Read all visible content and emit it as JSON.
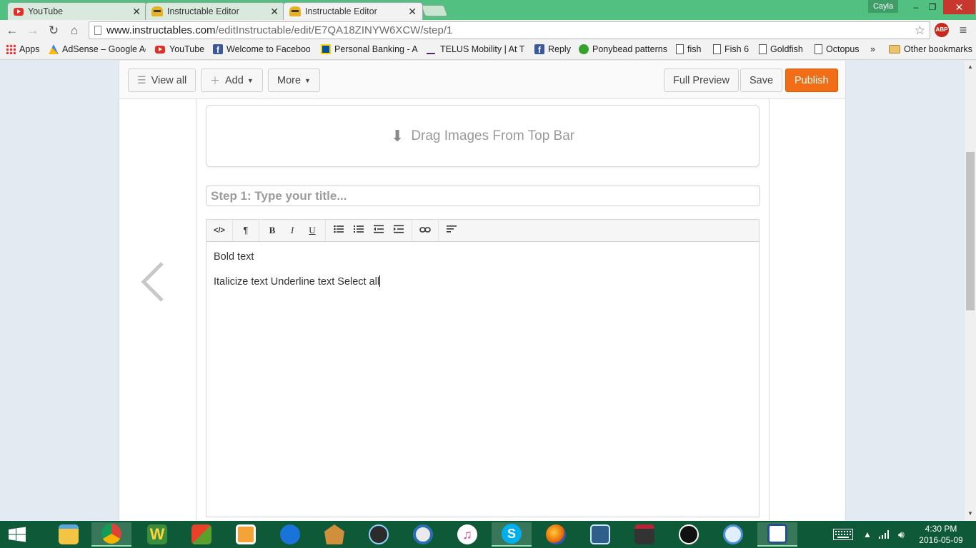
{
  "browser": {
    "tabs": [
      {
        "title": "YouTube",
        "icon": "youtube-icon"
      },
      {
        "title": "Instructable Editor",
        "icon": "instructables-robot-icon"
      },
      {
        "title": "Instructable Editor",
        "icon": "instructables-robot-icon",
        "active": true
      }
    ],
    "user": "Cayla",
    "window_controls": {
      "minimize": "–",
      "restore": "❐",
      "close": "✕"
    },
    "url_host": "www.instructables.com",
    "url_path": "/editInstructable/edit/E7QA18ZINYW6XCW/step/1",
    "abp_label": "ABP",
    "bookmarks": [
      {
        "label": "Apps",
        "icon": "apps-grid-icon"
      },
      {
        "label": "AdSense – Google Ad",
        "icon": "adsense-icon"
      },
      {
        "label": "YouTube",
        "icon": "youtube-icon"
      },
      {
        "label": "Welcome to Faceboo",
        "icon": "facebook-icon"
      },
      {
        "label": "Personal Banking - Ac",
        "icon": "rbc-icon"
      },
      {
        "label": "TELUS Mobility | At TE",
        "icon": "telus-icon"
      },
      {
        "label": "Reply",
        "icon": "facebook-icon"
      },
      {
        "label": "Ponybead patterns",
        "icon": "ponybead-icon"
      },
      {
        "label": "fish",
        "icon": "document-icon"
      },
      {
        "label": "Fish 6",
        "icon": "document-icon"
      },
      {
        "label": "Goldfish",
        "icon": "document-icon"
      },
      {
        "label": "Octopus",
        "icon": "document-icon"
      }
    ],
    "bookmarks_overflow": "»",
    "other_bookmarks": "Other bookmarks"
  },
  "editor": {
    "view_all": "View all",
    "add": "Add",
    "more": "More",
    "full_preview": "Full Preview",
    "save": "Save",
    "publish": "Publish",
    "accent_color": "#f26e16",
    "drop_zone": "Drag Images From Top Bar",
    "step_title_placeholder": "Step 1:  Type your title...",
    "rte_toolbar": [
      {
        "label": "</>",
        "name": "html-source-button"
      },
      {
        "label": "¶",
        "name": "paragraph-format-button"
      },
      {
        "label": "B",
        "name": "bold-button"
      },
      {
        "label": "I",
        "name": "italic-button"
      },
      {
        "label": "U",
        "name": "underline-button"
      },
      {
        "label": "unordered-list",
        "name": "bullet-list-button"
      },
      {
        "label": "ordered-list",
        "name": "numbered-list-button"
      },
      {
        "label": "outdent",
        "name": "outdent-button"
      },
      {
        "label": "indent",
        "name": "indent-button"
      },
      {
        "label": "link",
        "name": "link-button"
      },
      {
        "label": "align",
        "name": "align-button"
      }
    ],
    "body_lines": [
      "Bold text",
      "Italicize text Underline text Select all"
    ]
  },
  "taskbar": {
    "time": "4:30 PM",
    "date": "2016-05-09",
    "apps": [
      "file-explorer",
      "chrome",
      "wunderlist",
      "office",
      "media-player",
      "maxthon",
      "winrar-museum",
      "video-editor",
      "lens",
      "itunes",
      "skype",
      "firefox",
      "remote-desktop",
      "hiredcam",
      "media-player-classic",
      "safari",
      "solitaire"
    ]
  }
}
